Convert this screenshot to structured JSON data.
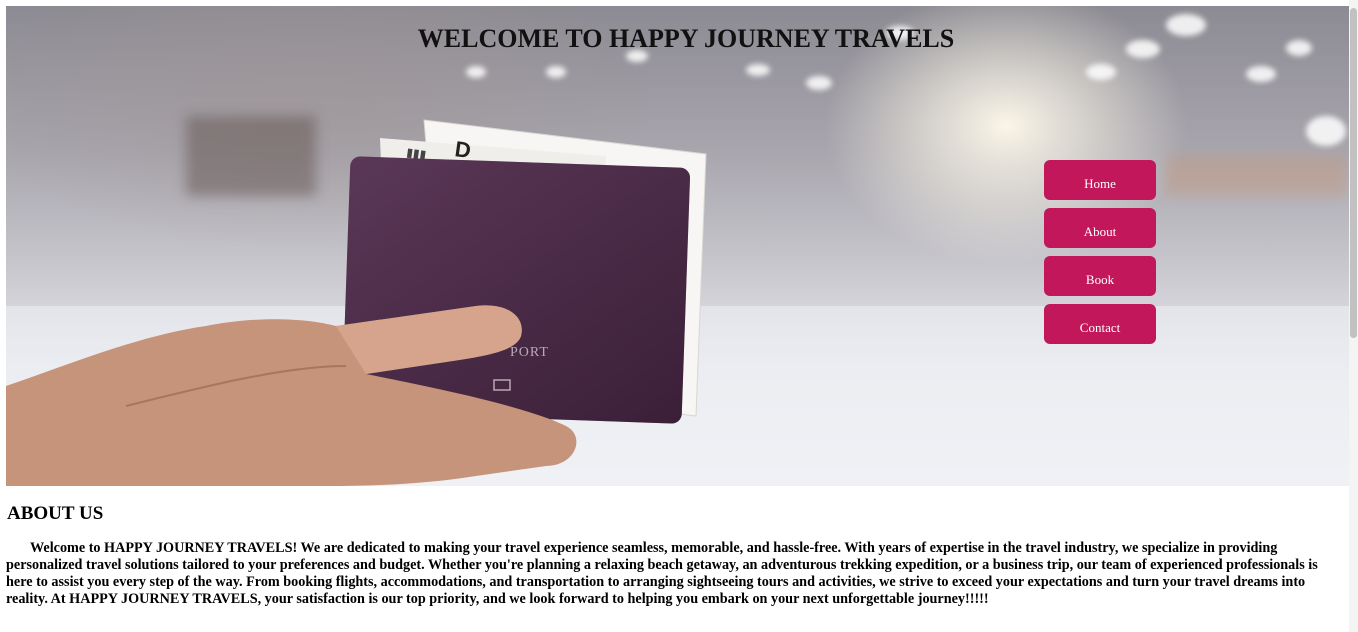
{
  "hero": {
    "title": "WELCOME TO HAPPY JOURNEY TRAVELS",
    "image_subject": "hand holding passport with ticket in airport terminal"
  },
  "nav": {
    "items": [
      {
        "label": "Home"
      },
      {
        "label": "About"
      },
      {
        "label": "Book"
      },
      {
        "label": "Contact"
      }
    ],
    "button_color": "#c2185b",
    "text_color": "#ffffff"
  },
  "about": {
    "title": "ABOUT US",
    "body": "Welcome to HAPPY JOURNEY TRAVELS! We are dedicated to making your travel experience seamless, memorable, and hassle-free. With years of expertise in the travel industry, we specialize in providing personalized travel solutions tailored to your preferences and budget. Whether you're planning a relaxing beach getaway, an adventurous trekking expedition, or a business trip, our team of experienced professionals is here to assist you every step of the way. From booking flights, accommodations, and transportation to arranging sightseeing tours and activities, we strive to exceed your expectations and turn your travel dreams into reality. At HAPPY JOURNEY TRAVELS, your satisfaction is our top priority, and we look forward to helping you embark on your next unforgettable journey!!!!!"
  }
}
